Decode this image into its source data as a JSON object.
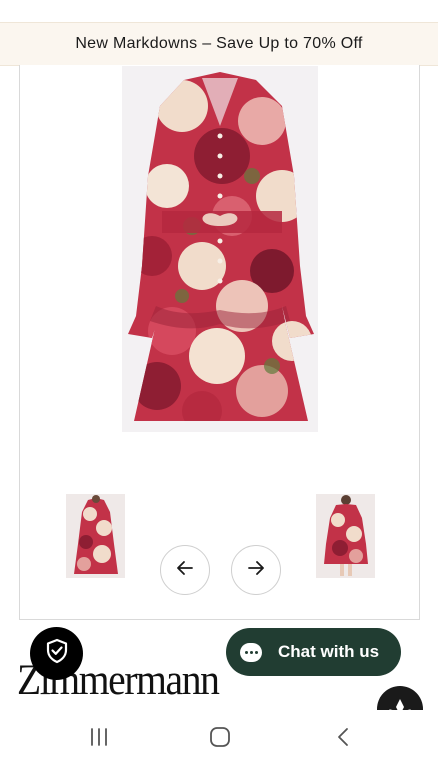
{
  "promo_banner": {
    "text": "New Markdowns – Save Up to 70% Off"
  },
  "product_gallery": {
    "main_image_alt": "Floral print long-sleeve mini dress",
    "thumbnails": [
      "front view thumbnail",
      "alternate view thumbnail"
    ],
    "prev_icon": "arrow-left-icon",
    "next_icon": "arrow-right-icon"
  },
  "brand": {
    "name": "Zimmermann"
  },
  "chat": {
    "label": "Chat with us",
    "icon": "chat-bubble-icon"
  },
  "badges": {
    "trust_icon": "shield-check-icon",
    "brand_logo_icon": "diamond-logo-icon"
  },
  "system_nav": {
    "recents_icon": "recents-icon",
    "home_icon": "home-icon",
    "back_icon": "back-icon"
  },
  "colors": {
    "promo_bg": "#fbf6ef",
    "chat_bg": "#213d32",
    "dress_red": "#b5283f",
    "dress_cream": "#f1dccb"
  }
}
